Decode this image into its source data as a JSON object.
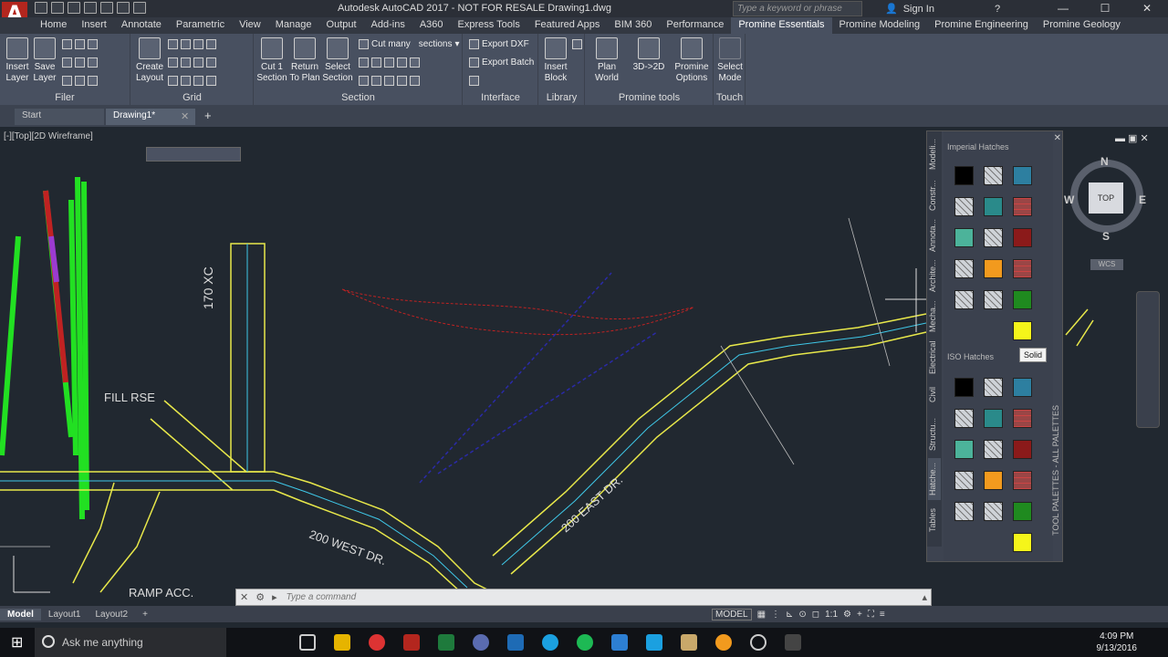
{
  "window": {
    "title": "Autodesk AutoCAD 2017 - NOT FOR RESALE   Drawing1.dwg",
    "search_placeholder": "Type a keyword or phrase",
    "sign_in": "Sign In"
  },
  "ribbon_tabs": [
    "Home",
    "Insert",
    "Annotate",
    "Parametric",
    "View",
    "Manage",
    "Output",
    "Add-ins",
    "A360",
    "Express Tools",
    "Featured Apps",
    "BIM 360",
    "Performance",
    "Promine Essentials",
    "Promine Modeling",
    "Promine Engineering",
    "Promine Geology"
  ],
  "active_tab": "Promine Essentials",
  "ribbon": {
    "filer": {
      "label": "Filer",
      "insert_layer": "Insert\nLayer",
      "save_layer": "Save\nLayer"
    },
    "grid": {
      "label": "Grid",
      "create_layout": "Create\nLayout"
    },
    "section": {
      "label": "Section",
      "cut1": "Cut 1\nSection",
      "return": "Return\nTo Plan",
      "select": "Select\nSection",
      "cut_many": "Cut many",
      "sections": "sections"
    },
    "interface": {
      "label": "Interface",
      "export_dxf": "Export DXF",
      "export_batch": "Export Batch"
    },
    "library": {
      "label": "Library",
      "insert_block": "Insert\nBlock"
    },
    "promine_tools": {
      "label": "Promine tools",
      "plan_world": "Plan\nWorld",
      "d3to2": "3D->2D",
      "options": "Promine\nOptions"
    },
    "touch": {
      "label": "Touch",
      "select_mode": "Select\nMode"
    }
  },
  "doc_tabs": [
    "Start",
    "Drawing1*"
  ],
  "viewport_label": "[-][Top][2D Wireframe]",
  "drawing_labels": {
    "c170": "170 XC",
    "fill": "FILL RSE",
    "west": "200 WEST DR.",
    "east": "200 EAST DR.",
    "ramp": "RAMP ACC."
  },
  "viewcube": {
    "n": "N",
    "s": "S",
    "e": "E",
    "w": "W",
    "top": "TOP",
    "wcs": "WCS"
  },
  "palette": {
    "side_tabs": [
      "Modeli...",
      "Constr...",
      "Annota...",
      "Archite...",
      "Mecha...",
      "Electrical",
      "Civil",
      "Structu...",
      "Hatche...",
      "Tables"
    ],
    "vertical_title": "TOOL PALETTES - ALL PALETTES",
    "imperial": "Imperial Hatches",
    "iso": "ISO Hatches",
    "tooltip": "Solid",
    "colors": {
      "black": "#000000",
      "teal": "#2a8a8a",
      "blue": "#2d7fa0",
      "red": "#8b1a1a",
      "mint": "#4cb39a",
      "orange": "#f29a1e",
      "green": "#1f8a1f",
      "yellow": "#f5f51a",
      "brick": "#9a4646",
      "pattern": "#cfd3d8"
    }
  },
  "command": {
    "placeholder": "Type a command"
  },
  "layouts": [
    "Model",
    "Layout1",
    "Layout2"
  ],
  "status": {
    "model": "MODEL",
    "scale": "1:1"
  },
  "taskbar": {
    "search": "Ask me anything",
    "time": "4:09 PM",
    "date": "9/13/2016"
  }
}
